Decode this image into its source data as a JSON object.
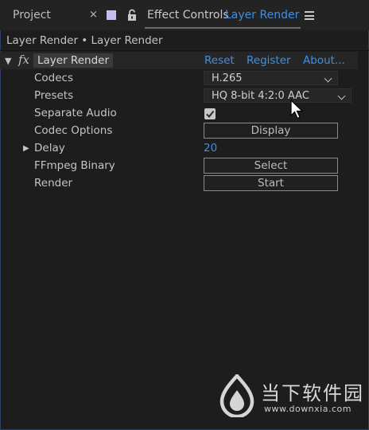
{
  "tabs": {
    "project": "Project",
    "close": "×",
    "effect_controls_label": "Effect Controls",
    "effect_controls_target": "Layer Render"
  },
  "breadcrumb": "Layer Render • Layer Render",
  "effect": {
    "name": "Layer Render",
    "links": {
      "reset": "Reset",
      "register": "Register",
      "about": "About..."
    }
  },
  "properties": {
    "codecs": {
      "label": "Codecs",
      "value": "H.265"
    },
    "presets": {
      "label": "Presets",
      "value": "HQ 8-bit 4:2:0 AAC"
    },
    "separate_audio": {
      "label": "Separate Audio",
      "checked": true
    },
    "codec_options": {
      "label": "Codec Options",
      "button": "Display"
    },
    "delay": {
      "label": "Delay",
      "value": "20"
    },
    "ffmpeg_binary": {
      "label": "FFmpeg Binary",
      "button": "Select"
    },
    "render": {
      "label": "Render",
      "button": "Start"
    }
  },
  "watermark": {
    "site_name": "当下软件园",
    "url": "www.downxia.com"
  },
  "colors": {
    "accent": "#3f8fe3",
    "background": "#1d1d1d",
    "swatch": "#c3c0f0",
    "frame": "#2d3f66"
  }
}
